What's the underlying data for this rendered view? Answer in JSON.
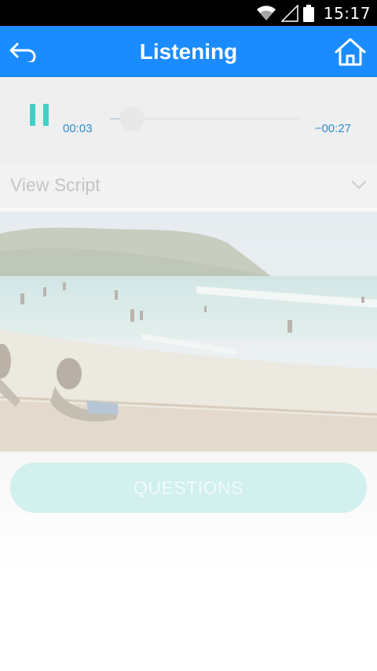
{
  "status_bar": {
    "time": "15:17",
    "icons": [
      "wifi-icon",
      "signal-icon",
      "battery-icon"
    ]
  },
  "app_bar": {
    "title": "Listening",
    "back_icon": "back-arrow-icon",
    "home_icon": "home-icon",
    "color": "#1a8cff"
  },
  "player": {
    "state_icon": "pause-icon",
    "current_time": "00:03",
    "remaining_time": "−00:27",
    "progress": 0.1,
    "accent_color": "#3fd1c4"
  },
  "script": {
    "label": "View Script",
    "toggle_icon": "chevron-down-icon"
  },
  "photo": {
    "alt": "beach-photo"
  },
  "questions": {
    "label": "QUESTIONS",
    "color": "#d1f0ee"
  }
}
